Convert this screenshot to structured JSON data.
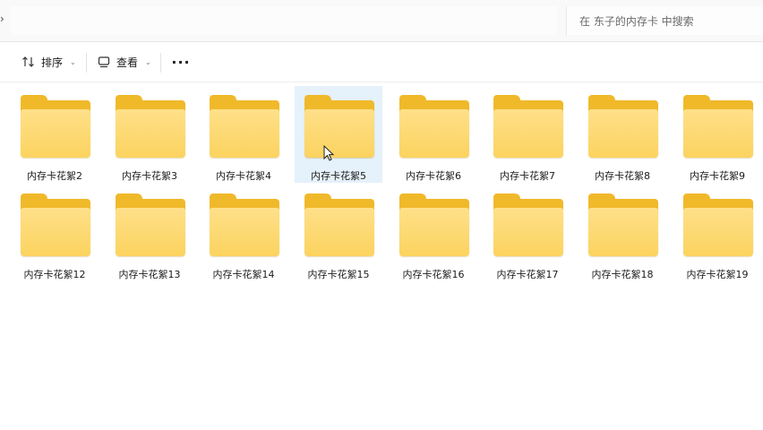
{
  "search": {
    "placeholder": "在 东子的内存卡 中搜索"
  },
  "toolbar": {
    "sort_label": "排序",
    "view_label": "查看"
  },
  "folders": [
    "内存卡花絮2",
    "内存卡花絮3",
    "内存卡花絮4",
    "内存卡花絮5",
    "内存卡花絮6",
    "内存卡花絮7",
    "内存卡花絮8",
    "内存卡花絮9",
    "内存卡花絮12",
    "内存卡花絮13",
    "内存卡花絮14",
    "内存卡花絮15",
    "内存卡花絮16",
    "内存卡花絮17",
    "内存卡花絮18",
    "内存卡花絮19"
  ],
  "selected_folder": "内存卡花絮5",
  "colors": {
    "folder_back": "#f0b92a",
    "folder_front": "#fbd35f",
    "selection": "#e5f1fb"
  }
}
